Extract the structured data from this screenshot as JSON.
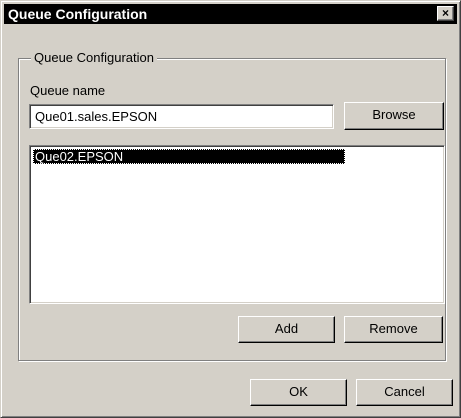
{
  "window": {
    "title": "Queue Configuration",
    "close_glyph": "×"
  },
  "group": {
    "legend": "Queue Configuration"
  },
  "queue_name": {
    "label": "Queue name",
    "value": "Que01.sales.EPSON"
  },
  "buttons": {
    "browse": "Browse",
    "add": "Add",
    "remove": "Remove",
    "ok": "OK",
    "cancel": "Cancel"
  },
  "queue_list": {
    "items": [
      {
        "label": "Que02.EPSON",
        "selected": true
      }
    ]
  },
  "colors": {
    "face": "#d4d0c8",
    "titlebar": "#000000",
    "selection": "#000000"
  }
}
